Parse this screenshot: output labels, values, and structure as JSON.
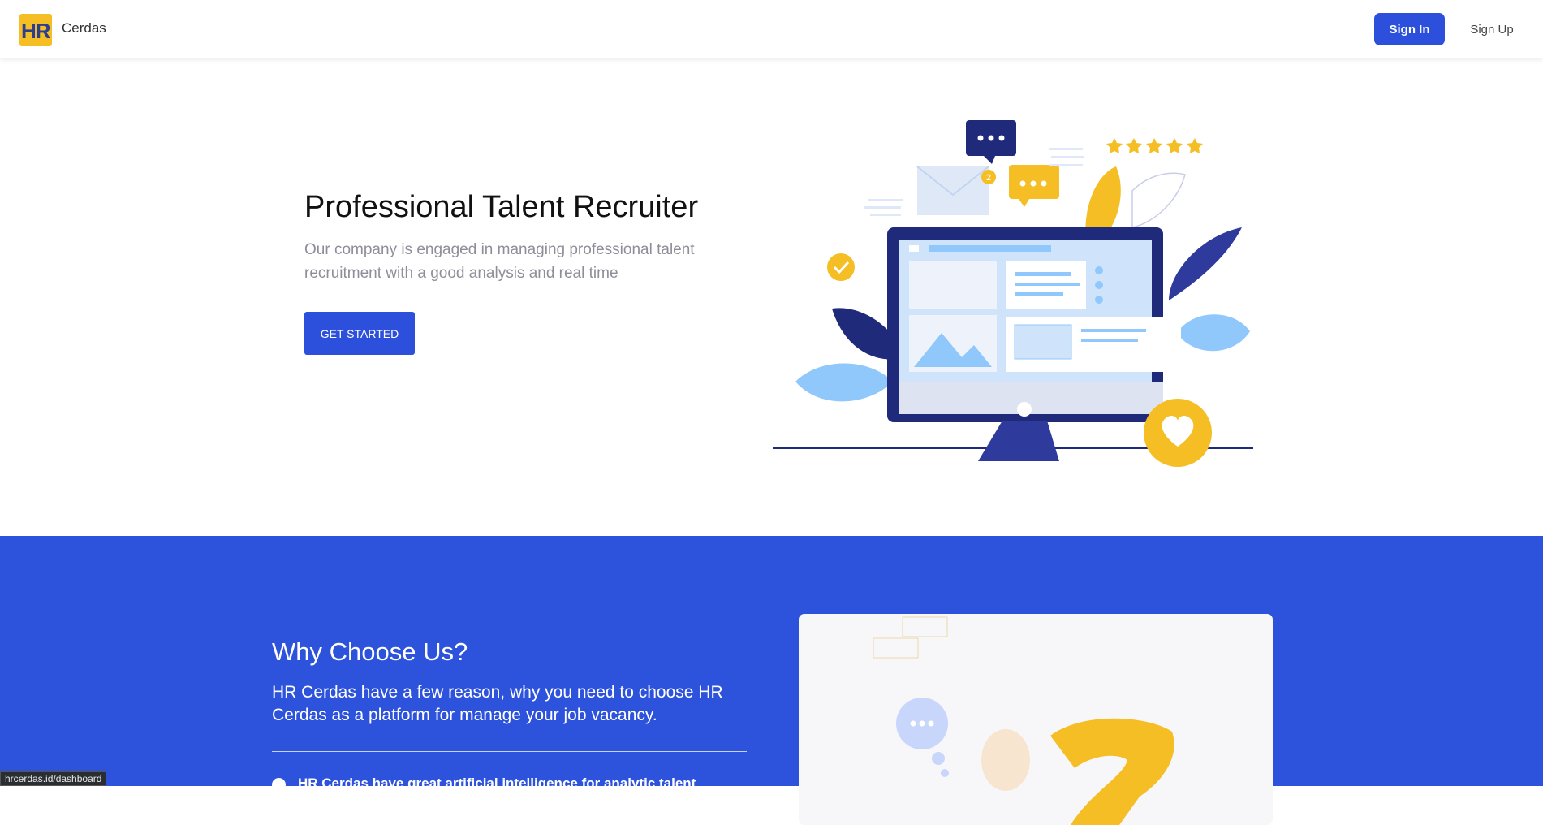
{
  "nav": {
    "logo_text": "HR",
    "brand": "Cerdas",
    "signin_label": "Sign In",
    "signup_label": "Sign Up"
  },
  "hero": {
    "title": "Professional Talent Recruiter",
    "subtitle": "Our company is engaged in managing professional talent recruitment with a good analysis and real time",
    "cta_label": "GET STARTED",
    "notification_count": "2",
    "rating_stars": 5
  },
  "why": {
    "title": "Why Choose Us?",
    "description": "HR Cerdas have a few reason, why you need to choose HR Cerdas as a platform for manage your job vacancy.",
    "items": [
      {
        "text": "HR Cerdas have great artificial intelligence for analytic talent"
      }
    ]
  },
  "status_url": "hrcerdas.id/dashboard",
  "colors": {
    "primary": "#2c50dc",
    "accent": "#f4be24",
    "navy": "#1f2a7a",
    "light_blue": "#90c8fb"
  }
}
